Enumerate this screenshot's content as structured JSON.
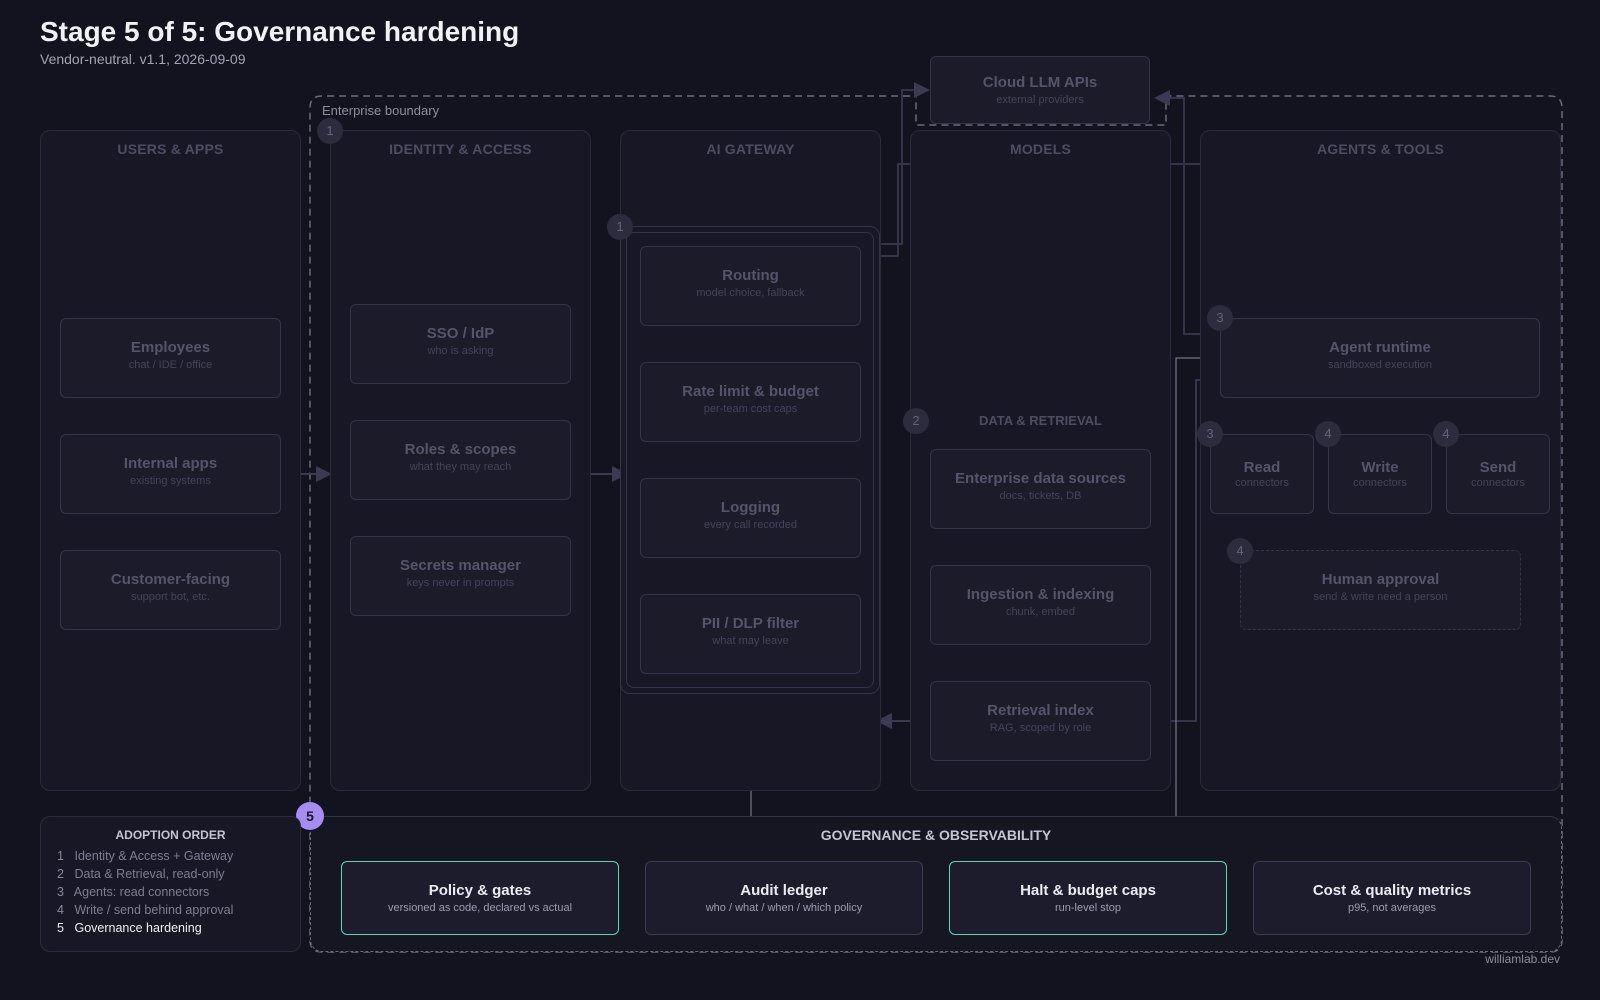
{
  "header": {
    "title": "Stage 5 of 5: Governance hardening",
    "subtitle": "Vendor-neutral. v1.1, 2026-09-09"
  },
  "boundary_label": "Enterprise boundary",
  "external": {
    "title": "Cloud LLM APIs",
    "sub": "external providers"
  },
  "lanes": {
    "users": {
      "title": "USERS & APPS",
      "items": [
        {
          "title": "Employees",
          "sub": "chat / IDE / office"
        },
        {
          "title": "Internal apps",
          "sub": "existing systems"
        },
        {
          "title": "Customer-facing",
          "sub": "support bot, etc."
        }
      ]
    },
    "identity": {
      "title": "IDENTITY & ACCESS",
      "badge": "1",
      "items": [
        {
          "title": "SSO / IdP",
          "sub": "who is asking"
        },
        {
          "title": "Roles & scopes",
          "sub": "what they may reach"
        },
        {
          "title": "Secrets manager",
          "sub": "keys never in prompts"
        }
      ]
    },
    "gateway": {
      "title": "AI GATEWAY",
      "badge": "1",
      "items": [
        {
          "title": "Routing",
          "sub": "model choice, fallback"
        },
        {
          "title": "Rate limit & budget",
          "sub": "per-team cost caps"
        },
        {
          "title": "Logging",
          "sub": "every call recorded"
        },
        {
          "title": "PII / DLP filter",
          "sub": "what may leave"
        }
      ]
    },
    "models": {
      "title": "MODELS",
      "subheading": "DATA & RETRIEVAL",
      "badge": "2",
      "items": [
        {
          "title": "Enterprise data sources",
          "sub": "docs, tickets, DB"
        },
        {
          "title": "Ingestion & indexing",
          "sub": "chunk, embed"
        },
        {
          "title": "Retrieval index",
          "sub": "RAG, scoped by role"
        }
      ]
    },
    "agents": {
      "title": "AGENTS & TOOLS",
      "runtime": {
        "title": "Agent runtime",
        "sub": "sandboxed execution",
        "badge": "3"
      },
      "connectors": [
        {
          "title": "Read",
          "sub": "connectors",
          "badge": "3"
        },
        {
          "title": "Write",
          "sub": "connectors",
          "badge": "4"
        },
        {
          "title": "Send",
          "sub": "connectors",
          "badge": "4"
        }
      ],
      "approval": {
        "title": "Human approval",
        "sub": "send & write need a person",
        "badge": "4"
      }
    }
  },
  "governance": {
    "title": "GOVERNANCE & OBSERVABILITY",
    "badge": "5",
    "items": [
      {
        "title": "Policy & gates",
        "sub": "versioned as code, declared vs actual"
      },
      {
        "title": "Audit ledger",
        "sub": "who / what / when / which policy"
      },
      {
        "title": "Halt & budget caps",
        "sub": "run-level stop"
      },
      {
        "title": "Cost & quality metrics",
        "sub": "p95, not averages"
      }
    ]
  },
  "adoption": {
    "title": "ADOPTION ORDER",
    "steps": [
      {
        "n": "1",
        "label": "Identity & Access + Gateway"
      },
      {
        "n": "2",
        "label": "Data & Retrieval, read-only"
      },
      {
        "n": "3",
        "label": "Agents: read connectors"
      },
      {
        "n": "4",
        "label": "Write / send behind approval"
      },
      {
        "n": "5",
        "label": "Governance hardening"
      }
    ]
  },
  "footer": "williamlab.dev",
  "colors": {
    "background": "#13131f",
    "highlight": "#5ad6b0",
    "active_badge": "#a58cf0",
    "boundary": "#6a6a7e"
  }
}
